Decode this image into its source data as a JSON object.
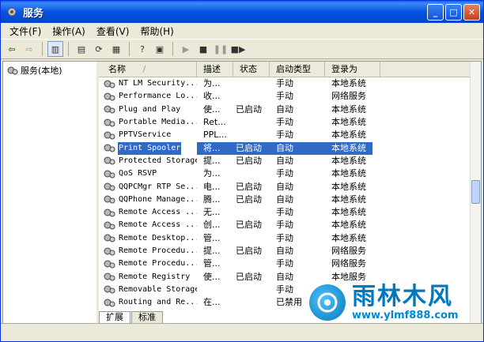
{
  "window": {
    "title": "服务"
  },
  "menu": [
    "文件(F)",
    "操作(A)",
    "查看(V)",
    "帮助(H)"
  ],
  "tree": {
    "root": "服务(本地)"
  },
  "columns": [
    "名称",
    "描述",
    "状态",
    "启动类型",
    "登录为"
  ],
  "sort_indicator": "/",
  "rows": [
    {
      "name": "NT LM Security...",
      "desc": "为...",
      "status": "",
      "startup": "手动",
      "logon": "本地系统"
    },
    {
      "name": "Performance Lo...",
      "desc": "收...",
      "status": "",
      "startup": "手动",
      "logon": "网络服务"
    },
    {
      "name": "Plug and Play",
      "desc": "使...",
      "status": "已启动",
      "startup": "自动",
      "logon": "本地系统"
    },
    {
      "name": "Portable Media...",
      "desc": "Ret...",
      "status": "",
      "startup": "手动",
      "logon": "本地系统"
    },
    {
      "name": "PPTVService",
      "desc": "PPL...",
      "status": "",
      "startup": "手动",
      "logon": "本地系统"
    },
    {
      "name": "Print Spooler",
      "desc": "将...",
      "status": "已启动",
      "startup": "自动",
      "logon": "本地系统",
      "selected": true
    },
    {
      "name": "Protected Storage",
      "desc": "提...",
      "status": "已启动",
      "startup": "自动",
      "logon": "本地系统"
    },
    {
      "name": "QoS RSVP",
      "desc": "为...",
      "status": "",
      "startup": "手动",
      "logon": "本地系统"
    },
    {
      "name": "QQPCMgr RTP Se...",
      "desc": "电...",
      "status": "已启动",
      "startup": "自动",
      "logon": "本地系统"
    },
    {
      "name": "QQPhone Manage...",
      "desc": "腾...",
      "status": "已启动",
      "startup": "自动",
      "logon": "本地系统"
    },
    {
      "name": "Remote Access ...",
      "desc": "无...",
      "status": "",
      "startup": "手动",
      "logon": "本地系统"
    },
    {
      "name": "Remote Access ...",
      "desc": "创...",
      "status": "已启动",
      "startup": "手动",
      "logon": "本地系统"
    },
    {
      "name": "Remote Desktop...",
      "desc": "管...",
      "status": "",
      "startup": "手动",
      "logon": "本地系统"
    },
    {
      "name": "Remote Procedu...",
      "desc": "提...",
      "status": "已启动",
      "startup": "自动",
      "logon": "网络服务"
    },
    {
      "name": "Remote Procedu...",
      "desc": "管...",
      "status": "",
      "startup": "手动",
      "logon": "网络服务"
    },
    {
      "name": "Remote Registry",
      "desc": "使...",
      "status": "已启动",
      "startup": "自动",
      "logon": "本地服务"
    },
    {
      "name": "Removable Storage",
      "desc": "",
      "status": "",
      "startup": "手动",
      "logon": ""
    },
    {
      "name": "Routing and Re...",
      "desc": "在...",
      "status": "",
      "startup": "已禁用",
      "logon": ""
    }
  ],
  "tabs": [
    "扩展",
    "标准"
  ],
  "watermark": {
    "cn": "雨林木风",
    "url": "www.ylmf888.com"
  },
  "colors": {
    "title_bar": "#0454e4",
    "selection": "#316ac5",
    "watermark": "#0277bd"
  }
}
